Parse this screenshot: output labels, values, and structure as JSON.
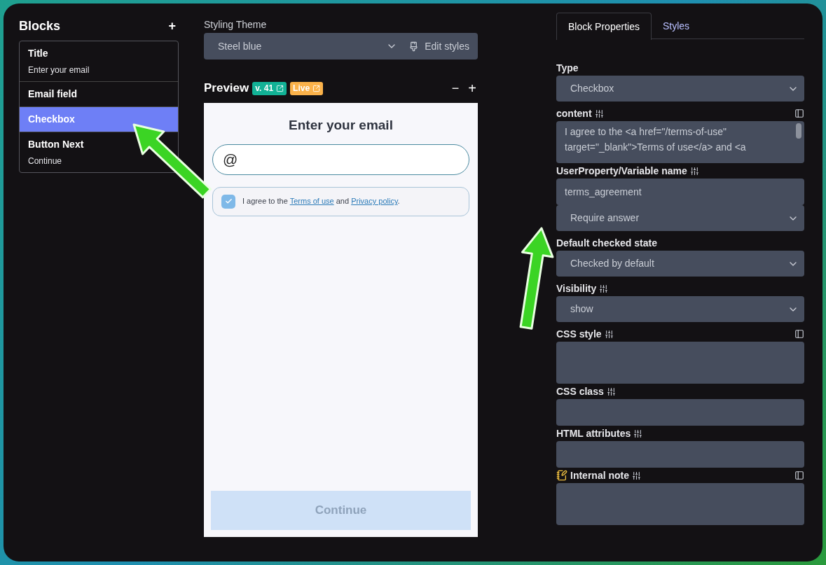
{
  "sidebar": {
    "title": "Blocks",
    "add": "+",
    "items": [
      {
        "title": "Title",
        "subtitle": "Enter your email",
        "selected": false
      },
      {
        "title": "Email field",
        "selected": false
      },
      {
        "title": "Checkbox",
        "selected": true
      },
      {
        "title": "Button Next",
        "subtitle": "Continue",
        "selected": false
      }
    ]
  },
  "theme": {
    "label": "Styling Theme",
    "value": "Steel blue",
    "edit_button": "Edit styles"
  },
  "preview": {
    "title": "Preview",
    "badges": [
      {
        "text": "v. 41",
        "color": "#12b296"
      },
      {
        "text": "Live",
        "color": "#fbb24a"
      }
    ],
    "zoom_out": "−",
    "zoom_in": "+",
    "heading": "Enter your email",
    "email_icon": "@",
    "checkbox": {
      "checked": true,
      "text_before": "I agree to the",
      "link_1": "Terms of use",
      "text_mid": "and",
      "link_2": "Privacy policy",
      "text_after": "."
    },
    "button": {
      "label": "Continue",
      "disabled": true
    }
  },
  "tabs": [
    {
      "label": "Block Properties",
      "selected": true
    },
    {
      "label": "Styles",
      "selected": false
    }
  ],
  "fields": [
    {
      "kind": "select",
      "label": "Type",
      "value": "Checkbox"
    },
    {
      "kind": "textarea",
      "label": "content",
      "settings": true,
      "expand": true,
      "value": "I agree to the <a href=\"/terms-of-use\" target=\"_blank\">Terms of use</a> and <a"
    },
    {
      "kind": "textarea",
      "label": "UserProperty/Variable name",
      "settings": true,
      "expand": false,
      "value": "terms_agreement"
    },
    {
      "kind": "select",
      "value": "Require answer"
    },
    {
      "kind": "select",
      "label": "Default checked state",
      "value": "Checked by default"
    },
    {
      "kind": "select",
      "label": "Visibility",
      "settings": true,
      "value": "show"
    },
    {
      "kind": "textarea",
      "label": "CSS style",
      "settings": true,
      "expand": true
    },
    {
      "kind": "textarea",
      "label": "CSS class",
      "settings": true,
      "expand": false
    },
    {
      "kind": "textarea",
      "label": "HTML attributes",
      "settings": true,
      "expand": false
    },
    {
      "kind": "textarea",
      "label": "Internal note",
      "note": true,
      "settings": true,
      "expand": true
    }
  ]
}
